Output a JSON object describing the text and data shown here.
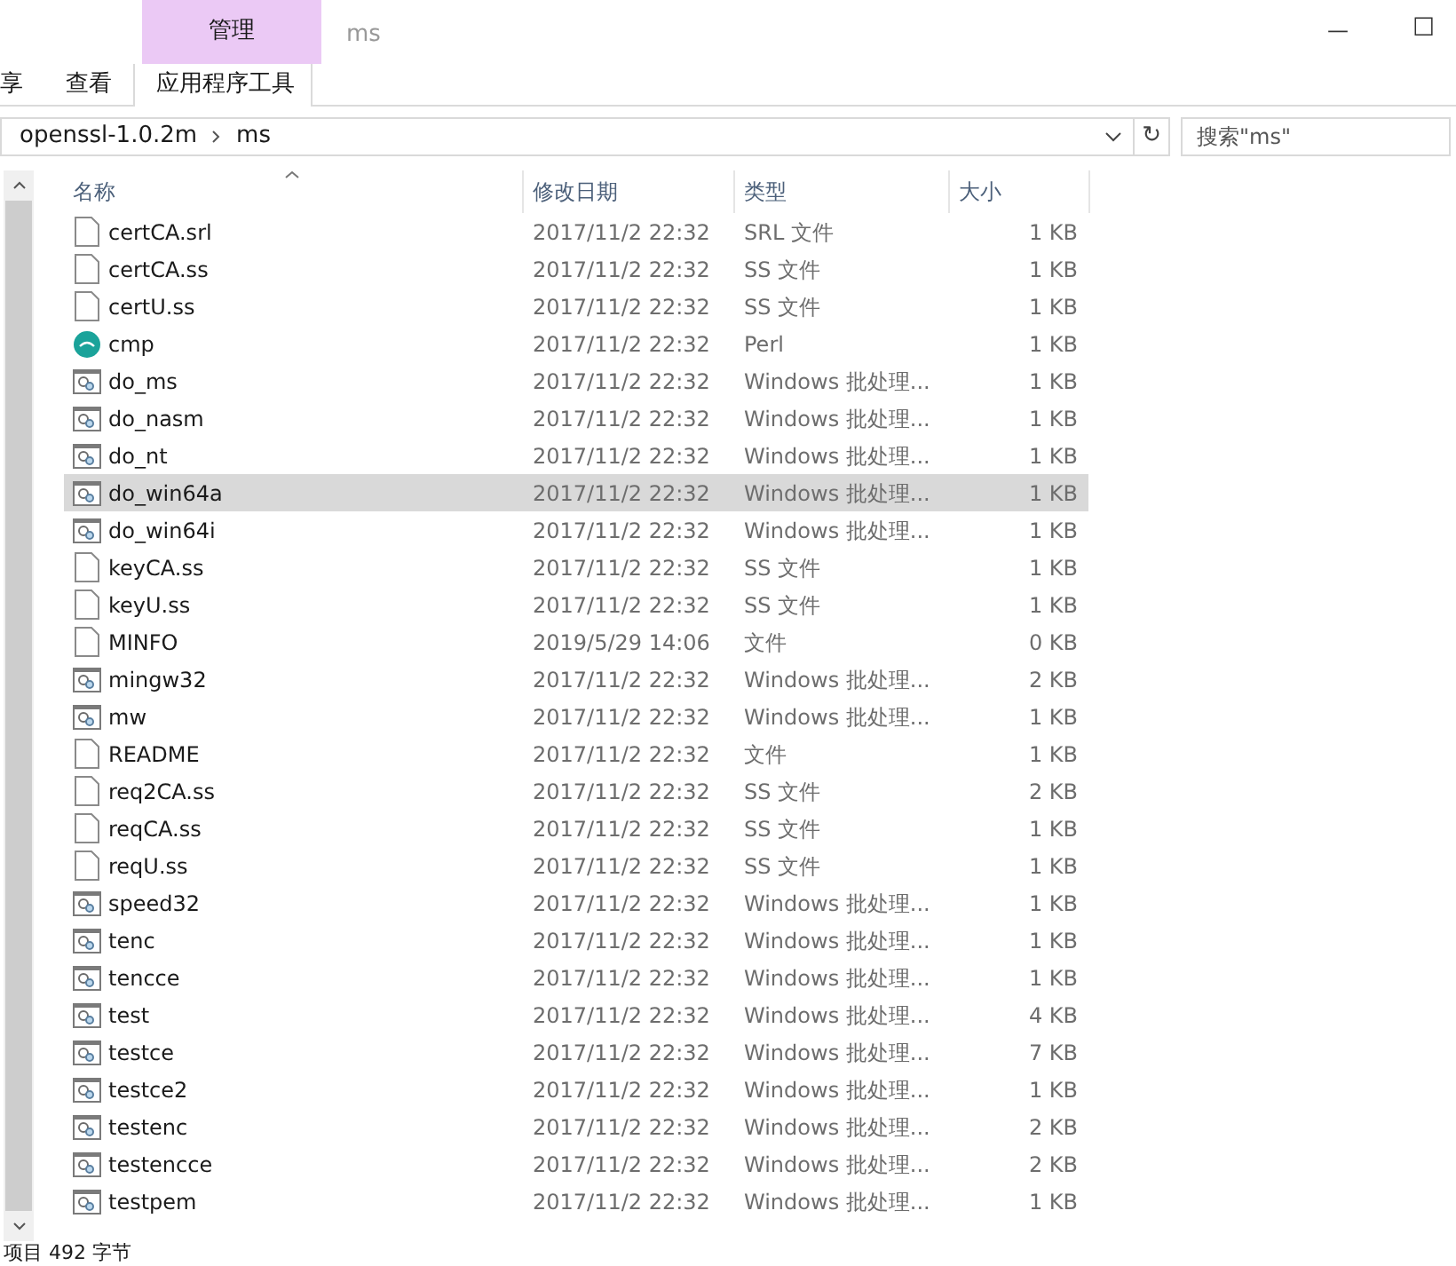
{
  "window": {
    "title": "ms",
    "context_tab": "管理",
    "minimize": "—",
    "maximize": "☐"
  },
  "ribbon_tabs": [
    {
      "label": "享",
      "selected": false
    },
    {
      "label": "查看",
      "selected": false
    },
    {
      "label": "应用程序工具",
      "selected": true
    }
  ],
  "address": {
    "path": [
      {
        "label": "openssl-1.0.2m"
      },
      {
        "label": "ms"
      }
    ],
    "refresh": "↻"
  },
  "search": {
    "placeholder": "搜索\"ms\""
  },
  "table": {
    "columns": [
      "名称",
      "修改日期",
      "类型",
      "大小"
    ],
    "rows": [
      {
        "name": "certCA.srl",
        "date": "2017/11/2 22:32",
        "type": "SRL 文件",
        "size": "1 KB",
        "kind": "file",
        "selected": false
      },
      {
        "name": "certCA.ss",
        "date": "2017/11/2 22:32",
        "type": "SS 文件",
        "size": "1 KB",
        "kind": "file",
        "selected": false
      },
      {
        "name": "certU.ss",
        "date": "2017/11/2 22:32",
        "type": "SS 文件",
        "size": "1 KB",
        "kind": "file",
        "selected": false
      },
      {
        "name": "cmp",
        "date": "2017/11/2 22:32",
        "type": "Perl",
        "size": "1 KB",
        "kind": "perl",
        "selected": false
      },
      {
        "name": "do_ms",
        "date": "2017/11/2 22:32",
        "type": "Windows 批处理...",
        "size": "1 KB",
        "kind": "batch",
        "selected": false
      },
      {
        "name": "do_nasm",
        "date": "2017/11/2 22:32",
        "type": "Windows 批处理...",
        "size": "1 KB",
        "kind": "batch",
        "selected": false
      },
      {
        "name": "do_nt",
        "date": "2017/11/2 22:32",
        "type": "Windows 批处理...",
        "size": "1 KB",
        "kind": "batch",
        "selected": false
      },
      {
        "name": "do_win64a",
        "date": "2017/11/2 22:32",
        "type": "Windows 批处理...",
        "size": "1 KB",
        "kind": "batch",
        "selected": true
      },
      {
        "name": "do_win64i",
        "date": "2017/11/2 22:32",
        "type": "Windows 批处理...",
        "size": "1 KB",
        "kind": "batch",
        "selected": false
      },
      {
        "name": "keyCA.ss",
        "date": "2017/11/2 22:32",
        "type": "SS 文件",
        "size": "1 KB",
        "kind": "file",
        "selected": false
      },
      {
        "name": "keyU.ss",
        "date": "2017/11/2 22:32",
        "type": "SS 文件",
        "size": "1 KB",
        "kind": "file",
        "selected": false
      },
      {
        "name": "MINFO",
        "date": "2019/5/29 14:06",
        "type": "文件",
        "size": "0 KB",
        "kind": "file",
        "selected": false
      },
      {
        "name": "mingw32",
        "date": "2017/11/2 22:32",
        "type": "Windows 批处理...",
        "size": "2 KB",
        "kind": "batch",
        "selected": false
      },
      {
        "name": "mw",
        "date": "2017/11/2 22:32",
        "type": "Windows 批处理...",
        "size": "1 KB",
        "kind": "batch",
        "selected": false
      },
      {
        "name": "README",
        "date": "2017/11/2 22:32",
        "type": "文件",
        "size": "1 KB",
        "kind": "file",
        "selected": false
      },
      {
        "name": "req2CA.ss",
        "date": "2017/11/2 22:32",
        "type": "SS 文件",
        "size": "2 KB",
        "kind": "file",
        "selected": false
      },
      {
        "name": "reqCA.ss",
        "date": "2017/11/2 22:32",
        "type": "SS 文件",
        "size": "1 KB",
        "kind": "file",
        "selected": false
      },
      {
        "name": "reqU.ss",
        "date": "2017/11/2 22:32",
        "type": "SS 文件",
        "size": "1 KB",
        "kind": "file",
        "selected": false
      },
      {
        "name": "speed32",
        "date": "2017/11/2 22:32",
        "type": "Windows 批处理...",
        "size": "1 KB",
        "kind": "batch",
        "selected": false
      },
      {
        "name": "tenc",
        "date": "2017/11/2 22:32",
        "type": "Windows 批处理...",
        "size": "1 KB",
        "kind": "batch",
        "selected": false
      },
      {
        "name": "tencce",
        "date": "2017/11/2 22:32",
        "type": "Windows 批处理...",
        "size": "1 KB",
        "kind": "batch",
        "selected": false
      },
      {
        "name": "test",
        "date": "2017/11/2 22:32",
        "type": "Windows 批处理...",
        "size": "4 KB",
        "kind": "batch",
        "selected": false
      },
      {
        "name": "testce",
        "date": "2017/11/2 22:32",
        "type": "Windows 批处理...",
        "size": "7 KB",
        "kind": "batch",
        "selected": false
      },
      {
        "name": "testce2",
        "date": "2017/11/2 22:32",
        "type": "Windows 批处理...",
        "size": "1 KB",
        "kind": "batch",
        "selected": false
      },
      {
        "name": "testenc",
        "date": "2017/11/2 22:32",
        "type": "Windows 批处理...",
        "size": "2 KB",
        "kind": "batch",
        "selected": false
      },
      {
        "name": "testencce",
        "date": "2017/11/2 22:32",
        "type": "Windows 批处理...",
        "size": "2 KB",
        "kind": "batch",
        "selected": false
      },
      {
        "name": "testpem",
        "date": "2017/11/2 22:32",
        "type": "Windows 批处理...",
        "size": "1 KB",
        "kind": "batch",
        "selected": false
      }
    ]
  },
  "status_bar": {
    "text": "项目 492 字节"
  }
}
